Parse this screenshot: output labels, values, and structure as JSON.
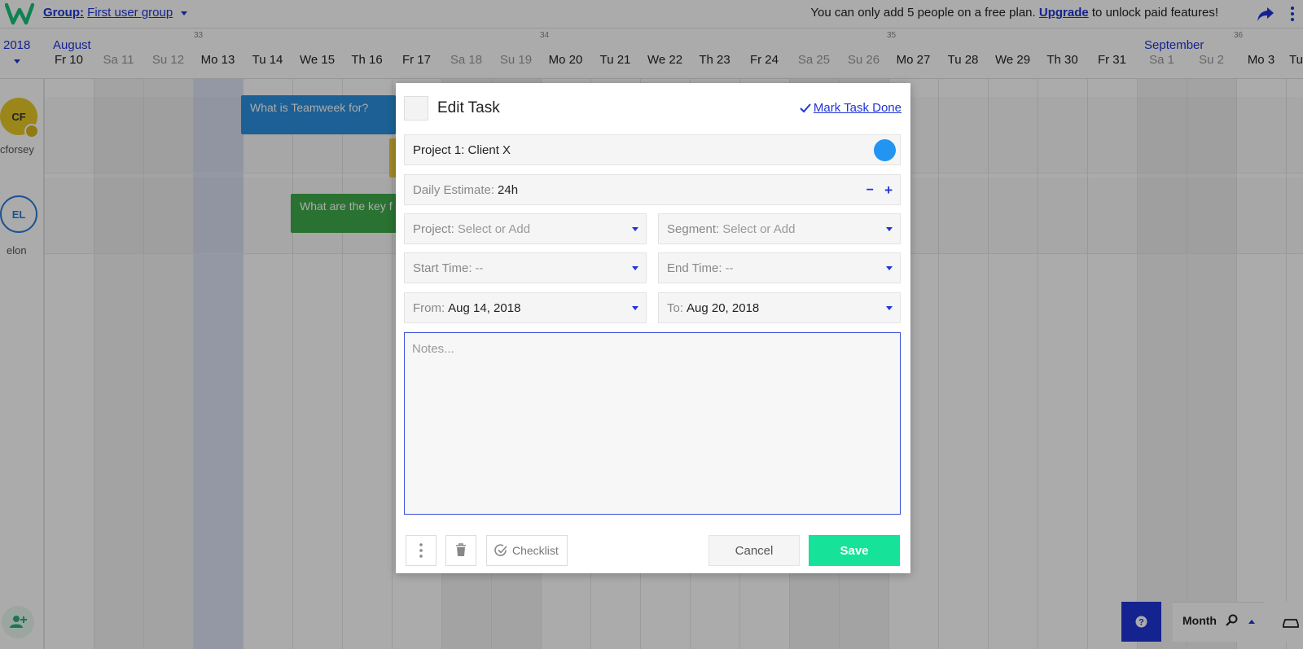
{
  "topbar": {
    "group_label": "Group:",
    "group_name": "First user group",
    "notice_text": "You can only add 5 people on a free plan.",
    "upgrade_link": "Upgrade",
    "notice_suffix": "to unlock paid features!"
  },
  "calendar": {
    "year": "2018",
    "months": [
      "August",
      "September"
    ],
    "week_numbers": [
      "33",
      "34",
      "35",
      "36"
    ],
    "days": [
      {
        "label": "Fr 10",
        "weekend": false
      },
      {
        "label": "Sa 11",
        "weekend": true
      },
      {
        "label": "Su 12",
        "weekend": true
      },
      {
        "label": "Mo 13",
        "weekend": false
      },
      {
        "label": "Tu 14",
        "weekend": false
      },
      {
        "label": "We 15",
        "weekend": false
      },
      {
        "label": "Th 16",
        "weekend": false
      },
      {
        "label": "Fr 17",
        "weekend": false
      },
      {
        "label": "Sa 18",
        "weekend": true
      },
      {
        "label": "Su 19",
        "weekend": true
      },
      {
        "label": "Mo 20",
        "weekend": false
      },
      {
        "label": "Tu 21",
        "weekend": false
      },
      {
        "label": "We 22",
        "weekend": false
      },
      {
        "label": "Th 23",
        "weekend": false
      },
      {
        "label": "Fr 24",
        "weekend": false
      },
      {
        "label": "Sa 25",
        "weekend": true
      },
      {
        "label": "Su 26",
        "weekend": true
      },
      {
        "label": "Mo 27",
        "weekend": false
      },
      {
        "label": "Tu 28",
        "weekend": false
      },
      {
        "label": "We 29",
        "weekend": false
      },
      {
        "label": "Th 30",
        "weekend": false
      },
      {
        "label": "Fr 31",
        "weekend": false
      },
      {
        "label": "Sa 1",
        "weekend": true
      },
      {
        "label": "Su 2",
        "weekend": true
      },
      {
        "label": "Mo 3",
        "weekend": false
      },
      {
        "label": "Tu",
        "weekend": false
      }
    ],
    "users": [
      {
        "initials": "CF",
        "name": "cforsey"
      },
      {
        "initials": "EL",
        "name": "elon"
      }
    ],
    "tasks": [
      {
        "title": "What is Teamweek for?",
        "color": "#2b8fdf"
      },
      {
        "title": "What are the key f",
        "color": "#3faa4a"
      }
    ]
  },
  "controls": {
    "help_icon": "question-icon",
    "view_label": "Month"
  },
  "modal": {
    "title": "Edit Task",
    "mark_done": "Mark Task Done",
    "project_client": "Project 1: Client X",
    "project_color": "#2294f2",
    "estimate_label": "Daily Estimate:",
    "estimate_value": "24h",
    "estimate_minus": "−",
    "estimate_plus": "+",
    "project_label": "Project:",
    "project_placeholder": "Select or Add",
    "segment_label": "Segment:",
    "segment_placeholder": "Select or Add",
    "start_label": "Start Time:",
    "start_value": "--",
    "end_label": "End Time:",
    "end_value": "--",
    "from_label": "From:",
    "from_value": "Aug 14, 2018",
    "to_label": "To:",
    "to_value": "Aug 20, 2018",
    "notes_placeholder": "Notes...",
    "checklist_label": "Checklist",
    "cancel_label": "Cancel",
    "save_label": "Save",
    "save_color": "#16e29a"
  }
}
